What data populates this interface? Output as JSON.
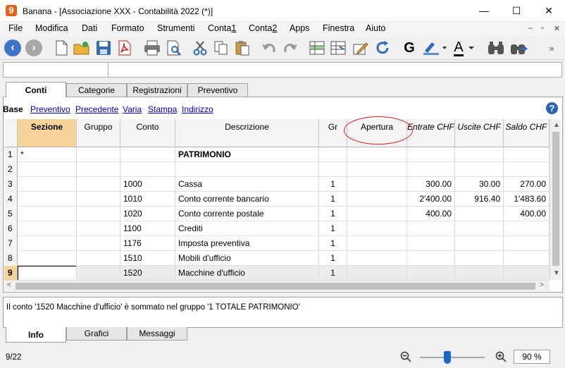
{
  "window": {
    "icon_glyph": "9",
    "title": "Banana - [Associazione XXX - Contabilità 2022 (*)]",
    "minimize_glyph": "—",
    "maximize_glyph": "☐",
    "close_glyph": "✕"
  },
  "menu": [
    "File",
    "Modifica",
    "Dati",
    "Formato",
    "Strumenti",
    "Conta1",
    "Conta2",
    "Apps",
    "Finestra",
    "Aiuto"
  ],
  "mdi_controls": [
    "–",
    "▫",
    "✕"
  ],
  "toolbar": {
    "back_glyph": "‹",
    "forward_glyph": "›",
    "bold_glyph": "G",
    "font_color_glyph": "A",
    "more_glyph": "»"
  },
  "tabs_top": [
    "Conti",
    "Categorie",
    "Registrazioni",
    "Preventivo"
  ],
  "views": [
    "Base",
    "Preventivo",
    "Precedente",
    "Varia",
    "Stampa",
    "Indirizzo"
  ],
  "help_glyph": "?",
  "table": {
    "columns": [
      "Sezione",
      "Gruppo",
      "Conto",
      "Descrizione",
      "Gr",
      "Apertura",
      "Entrate CHF",
      "Uscite CHF",
      "Saldo CHF"
    ],
    "rows": [
      {
        "n": "1",
        "sezione": "*",
        "gruppo": "",
        "conto": "",
        "descrizione": "PATRIMONIO",
        "gr": "",
        "apertura": "",
        "entrate": "",
        "uscite": "",
        "saldo": ""
      },
      {
        "n": "2",
        "sezione": "",
        "gruppo": "",
        "conto": "",
        "descrizione": "",
        "gr": "",
        "apertura": "",
        "entrate": "",
        "uscite": "",
        "saldo": ""
      },
      {
        "n": "3",
        "sezione": "",
        "gruppo": "",
        "conto": "1000",
        "descrizione": "Cassa",
        "gr": "1",
        "apertura": "",
        "entrate": "300.00",
        "uscite": "30.00",
        "saldo": "270.00"
      },
      {
        "n": "4",
        "sezione": "",
        "gruppo": "",
        "conto": "1010",
        "descrizione": "Conto  corrente bancario",
        "gr": "1",
        "apertura": "",
        "entrate": "2'400.00",
        "uscite": "916.40",
        "saldo": "1'483.60"
      },
      {
        "n": "5",
        "sezione": "",
        "gruppo": "",
        "conto": "1020",
        "descrizione": "Conto corrente postale",
        "gr": "1",
        "apertura": "",
        "entrate": "400.00",
        "uscite": "",
        "saldo": "400.00"
      },
      {
        "n": "6",
        "sezione": "",
        "gruppo": "",
        "conto": "1100",
        "descrizione": "Crediti",
        "gr": "1",
        "apertura": "",
        "entrate": "",
        "uscite": "",
        "saldo": ""
      },
      {
        "n": "7",
        "sezione": "",
        "gruppo": "",
        "conto": "1176",
        "descrizione": "Imposta preventiva",
        "gr": "1",
        "apertura": "",
        "entrate": "",
        "uscite": "",
        "saldo": ""
      },
      {
        "n": "8",
        "sezione": "",
        "gruppo": "",
        "conto": "1510",
        "descrizione": "Mobili d'ufficio",
        "gr": "1",
        "apertura": "",
        "entrate": "",
        "uscite": "",
        "saldo": ""
      },
      {
        "n": "9",
        "sezione": "",
        "gruppo": "",
        "conto": "1520",
        "descrizione": "Macchine d'ufficio",
        "gr": "1",
        "apertura": "",
        "entrate": "",
        "uscite": "",
        "saldo": ""
      }
    ]
  },
  "scroll": {
    "up": "▲",
    "down": "▼",
    "left": "<",
    "right": ">"
  },
  "info_message": "Il conto '1520 Macchine d'ufficio' è sommato nel gruppo '1 TOTALE PATRIMONIO'",
  "tabs_bottom": [
    "Info",
    "Grafici",
    "Messaggi"
  ],
  "status": {
    "position": "9/22",
    "zoom": "90  %",
    "zoom_level_percent": 90
  },
  "colors": {
    "accent": "#3b76c6",
    "selected_header": "#f7d39c",
    "annotation_ellipse": "#e01919"
  }
}
